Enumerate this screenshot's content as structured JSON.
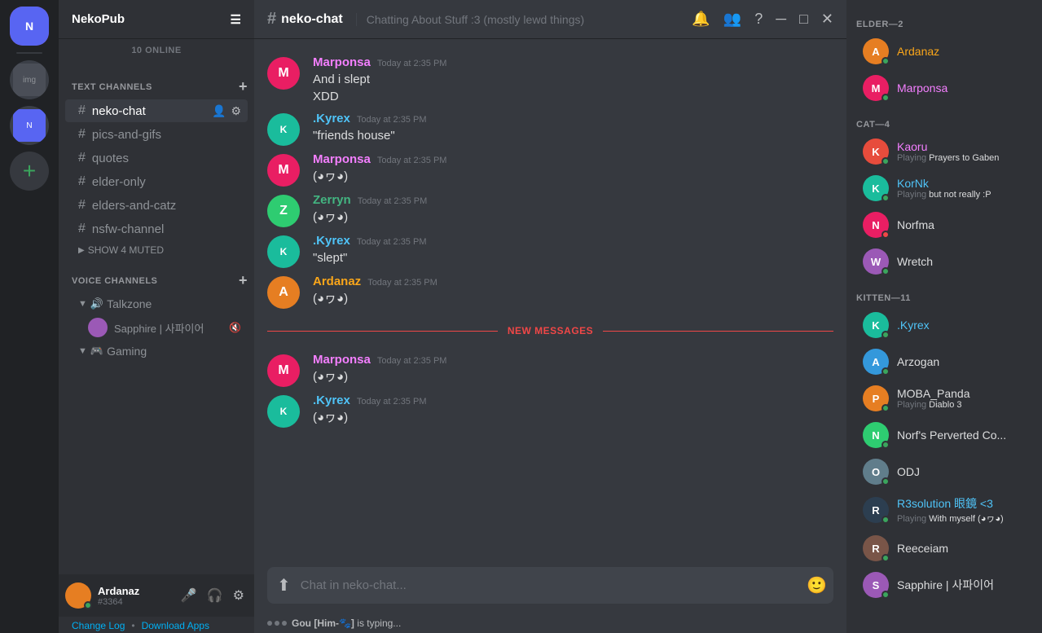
{
  "server": {
    "name": "NekoPub",
    "online_count": "10 ONLINE"
  },
  "header": {
    "channel": "neko-chat",
    "hash": "#",
    "description": "Chatting About Stuff :3 (mostly lewd things)",
    "icons": [
      "bell",
      "members",
      "question",
      "minimize",
      "maximize",
      "close"
    ]
  },
  "channels": {
    "text_section": "TEXT CHANNELS",
    "text_list": [
      {
        "name": "neko-chat",
        "active": true
      },
      {
        "name": "pics-and-gifs",
        "active": false
      },
      {
        "name": "quotes",
        "active": false
      },
      {
        "name": "elder-only",
        "active": false
      },
      {
        "name": "elders-and-catz",
        "active": false
      },
      {
        "name": "nsfw-channel",
        "active": false
      }
    ],
    "show_muted": "SHOW 4 MUTED",
    "voice_section": "VOICE CHANNELS",
    "voice_channels": [
      {
        "name": "Talkzone",
        "expanded": true,
        "users": [
          {
            "name": "Sapphire | 사파이어"
          }
        ]
      },
      {
        "name": "Gaming",
        "expanded": false,
        "users": []
      }
    ]
  },
  "messages": [
    {
      "author": "Marponsa",
      "author_color": "pink",
      "time": "Today at 2:35 PM",
      "text": "And i slept\nXDD",
      "avatar_color": "av-pink"
    },
    {
      "author": ".Kyrex",
      "author_color": "teal",
      "time": "Today at 2:35 PM",
      "text": "\"friends house\"",
      "avatar_color": "av-teal"
    },
    {
      "author": "Marponsa",
      "author_color": "pink",
      "time": "Today at 2:35 PM",
      "text": "(◕ヮ◕)",
      "avatar_color": "av-pink"
    },
    {
      "author": "Zerryn",
      "author_color": "green",
      "time": "Today at 2:35 PM",
      "text": "(◕ヮ◕)",
      "avatar_color": "av-green"
    },
    {
      "author": ".Kyrex",
      "author_color": "teal",
      "time": "Today at 2:35 PM",
      "text": "\"slept\"",
      "avatar_color": "av-teal"
    },
    {
      "author": "Ardanaz",
      "author_color": "orange",
      "time": "Today at 2:35 PM",
      "text": "(◕ヮ◕)",
      "avatar_color": "av-orange",
      "divider_before": true
    },
    {
      "author": "Marponsa",
      "author_color": "pink",
      "time": "Today at 2:35 PM",
      "text": "(◕ヮ◕)",
      "avatar_color": "av-pink",
      "after_divider": true
    },
    {
      "author": ".Kyrex",
      "author_color": "teal",
      "time": "Today at 2:35 PM",
      "text": "(◕ヮ◕)",
      "avatar_color": "av-teal"
    }
  ],
  "new_messages_label": "NEW MESSAGES",
  "input": {
    "placeholder": "Chat in neko-chat..."
  },
  "typing": {
    "text": "is typing...",
    "user": "Gou [Him-🐾]"
  },
  "footer": {
    "left": "Change Log",
    "separator": "•",
    "right": "Download Apps"
  },
  "members": {
    "sections": [
      {
        "title": "ELDER—2",
        "members": [
          {
            "name": "Ardanaz",
            "status": "online",
            "avatar_color": "av-orange",
            "initial": "A"
          },
          {
            "name": "Marponsa",
            "status": "online",
            "avatar_color": "av-pink",
            "initial": "M"
          }
        ]
      },
      {
        "title": "CAT—4",
        "members": [
          {
            "name": "Kaoru",
            "status": "online",
            "avatar_color": "av-red",
            "initial": "K",
            "activity": "Playing ",
            "activity_bold": "Prayers to Gaben"
          },
          {
            "name": "KorNk",
            "status": "online",
            "avatar_color": "av-teal",
            "initial": "K",
            "activity": "Playing ",
            "activity_bold": "but not really :P"
          },
          {
            "name": "Norfma",
            "status": "dnd",
            "avatar_color": "av-pink",
            "initial": "N"
          },
          {
            "name": "Wretch",
            "status": "online",
            "avatar_color": "av-purple",
            "initial": "W"
          }
        ]
      },
      {
        "title": "KITTEN—11",
        "members": [
          {
            "name": ".Kyrex",
            "status": "online",
            "avatar_color": "av-teal",
            "initial": "K"
          },
          {
            "name": "Arzogan",
            "status": "online",
            "avatar_color": "av-blue",
            "initial": "A"
          },
          {
            "name": "MOBA_Panda",
            "status": "online",
            "avatar_color": "av-orange",
            "initial": "P",
            "activity": "Playing ",
            "activity_bold": "Diablo 3"
          },
          {
            "name": "Norf's Perverted Co...",
            "status": "online",
            "avatar_color": "av-green",
            "initial": "N"
          },
          {
            "name": "ODJ",
            "status": "online",
            "avatar_color": "av-grey",
            "initial": "O"
          },
          {
            "name": "R3solution 眼鏡 <3",
            "status": "online",
            "avatar_color": "av-dark",
            "initial": "R",
            "activity": "Playing ",
            "activity_bold": "With myself (◕ヮ◕)"
          },
          {
            "name": "Reeceiam",
            "status": "online",
            "avatar_color": "av-brown",
            "initial": "R"
          },
          {
            "name": "Sapphire | 사파이어",
            "status": "online",
            "avatar_color": "av-purple",
            "initial": "S"
          }
        ]
      }
    ]
  },
  "current_user": {
    "name": "Ardanaz",
    "tag": "#3364",
    "avatar_color": "av-orange"
  }
}
